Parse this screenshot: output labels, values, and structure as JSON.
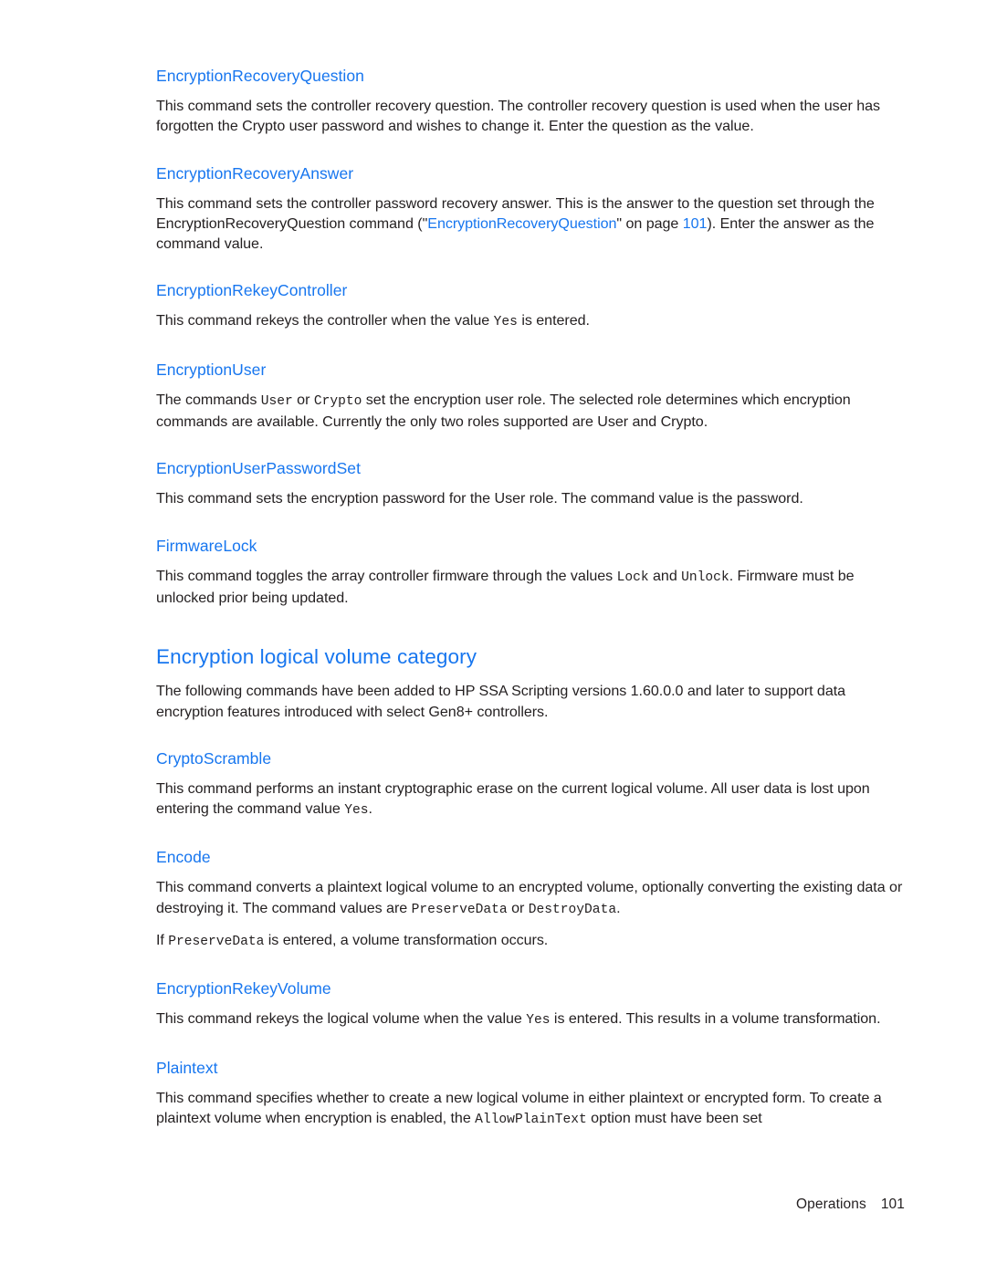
{
  "document": {
    "page_number": "101",
    "footer_label": "Operations"
  },
  "sections": [
    {
      "id": "encryption-recovery-question",
      "heading": "EncryptionRecoveryQuestion",
      "paragraphs": [
        {
          "parts": [
            {
              "type": "text",
              "value": "This command sets the controller recovery question. The controller recovery question is used when the user has forgotten the Crypto user password and wishes to change it. Enter the question as the value."
            }
          ]
        }
      ]
    },
    {
      "id": "encryption-recovery-answer",
      "heading": "EncryptionRecoveryAnswer",
      "paragraphs": [
        {
          "parts": [
            {
              "type": "text",
              "value": "This command sets the controller password recovery answer. This is the answer to the question set through the EncryptionRecoveryQuestion command (\""
            },
            {
              "type": "xref",
              "value": "EncryptionRecoveryQuestion"
            },
            {
              "type": "text",
              "value": "\" on page "
            },
            {
              "type": "pageref",
              "value": "101"
            },
            {
              "type": "text",
              "value": "). Enter the answer as the command value."
            }
          ]
        }
      ]
    },
    {
      "id": "encryption-rekey-controller",
      "heading": "EncryptionRekeyController",
      "paragraphs": [
        {
          "parts": [
            {
              "type": "text",
              "value": "This command rekeys the controller when the value "
            },
            {
              "type": "code",
              "value": "Yes"
            },
            {
              "type": "text",
              "value": " is entered."
            }
          ]
        }
      ]
    },
    {
      "id": "encryption-user",
      "heading": "EncryptionUser",
      "paragraphs": [
        {
          "parts": [
            {
              "type": "text",
              "value": "The commands "
            },
            {
              "type": "code",
              "value": "User"
            },
            {
              "type": "text",
              "value": " or "
            },
            {
              "type": "code",
              "value": "Crypto"
            },
            {
              "type": "text",
              "value": " set the encryption user role. The selected role determines which encryption commands are available. Currently the only two roles supported are User and Crypto."
            }
          ]
        }
      ]
    },
    {
      "id": "encryption-user-password-set",
      "heading": "EncryptionUserPasswordSet",
      "paragraphs": [
        {
          "parts": [
            {
              "type": "text",
              "value": "This command sets the encryption password for the User role. The command value is the password."
            }
          ]
        }
      ]
    },
    {
      "id": "firmware-lock",
      "heading": "FirmwareLock",
      "paragraphs": [
        {
          "parts": [
            {
              "type": "text",
              "value": "This command toggles the array controller firmware through the values "
            },
            {
              "type": "code",
              "value": "Lock"
            },
            {
              "type": "text",
              "value": " and "
            },
            {
              "type": "code",
              "value": "Unlock"
            },
            {
              "type": "text",
              "value": ". Firmware must be unlocked prior being updated."
            }
          ]
        }
      ]
    }
  ],
  "category": {
    "id": "encryption-logical-volume-category",
    "heading": "Encryption logical volume category",
    "intro": {
      "parts": [
        {
          "type": "text",
          "value": "The following commands have been added to HP SSA Scripting versions 1.60.0.0 and later to support data encryption features introduced with select Gen8+ controllers."
        }
      ]
    },
    "sections": [
      {
        "id": "crypto-scramble",
        "heading": "CryptoScramble",
        "paragraphs": [
          {
            "parts": [
              {
                "type": "text",
                "value": "This command performs an instant cryptographic erase on the current logical volume. All user data is lost upon entering the command value "
              },
              {
                "type": "code",
                "value": "Yes"
              },
              {
                "type": "text",
                "value": "."
              }
            ]
          }
        ]
      },
      {
        "id": "encode",
        "heading": "Encode",
        "paragraphs": [
          {
            "parts": [
              {
                "type": "text",
                "value": "This command converts a plaintext logical volume to an encrypted volume, optionally converting the existing data or destroying it. The command values are "
              },
              {
                "type": "code",
                "value": "PreserveData"
              },
              {
                "type": "text",
                "value": " or "
              },
              {
                "type": "code",
                "value": "DestroyData"
              },
              {
                "type": "text",
                "value": "."
              }
            ]
          },
          {
            "parts": [
              {
                "type": "text",
                "value": "If "
              },
              {
                "type": "code",
                "value": "PreserveData"
              },
              {
                "type": "text",
                "value": " is entered, a volume transformation occurs."
              }
            ]
          }
        ]
      },
      {
        "id": "encryption-rekey-volume",
        "heading": "EncryptionRekeyVolume",
        "paragraphs": [
          {
            "parts": [
              {
                "type": "text",
                "value": "This command rekeys the logical volume when the value "
              },
              {
                "type": "code",
                "value": "Yes"
              },
              {
                "type": "text",
                "value": " is entered. This results in a volume transformation."
              }
            ]
          }
        ]
      },
      {
        "id": "plaintext",
        "heading": "Plaintext",
        "paragraphs": [
          {
            "parts": [
              {
                "type": "text",
                "value": "This command specifies whether to create a new logical volume in either plaintext or encrypted form. To create a plaintext volume when encryption is enabled, the "
              },
              {
                "type": "code",
                "value": "AllowPlainText"
              },
              {
                "type": "text",
                "value": " option must have been set"
              }
            ]
          }
        ]
      }
    ]
  },
  "colors": {
    "heading_blue": "#1776ef",
    "body_text": "#231f20",
    "page_background": "#ffffff"
  }
}
